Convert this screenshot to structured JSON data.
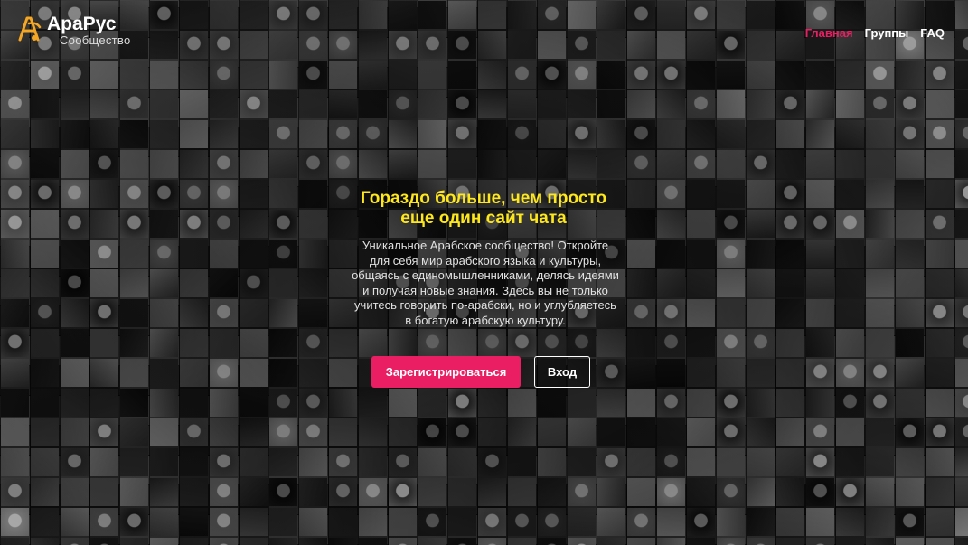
{
  "brand": {
    "name": "АраРус",
    "subtitle": "Сообщество",
    "accent_color": "#f5a623"
  },
  "nav": {
    "items": [
      {
        "label": "Главная",
        "active": true
      },
      {
        "label": "Группы",
        "active": false
      },
      {
        "label": "FAQ",
        "active": false
      }
    ],
    "active_color": "#e91e63"
  },
  "hero": {
    "title_line1": "Гораздо больше, чем просто",
    "title_line2": "еще один сайт чата",
    "title_color": "#ffe819",
    "text_lines": [
      "Уникальное Арабское сообщество! Откройте",
      "для себя мир арабского языка и культуры,",
      "общаясь с единомышленниками, делясь идеями",
      "и получая новые знания. Здесь вы не только",
      "учитесь говорить по-арабски, но и углубляетесь",
      "в богатую арабскую культуру."
    ],
    "register_label": "Зарегистрироваться",
    "login_label": "Вход",
    "register_color": "#e91e63"
  },
  "background": {
    "type": "photo-mosaic",
    "tint": "grayscale"
  }
}
